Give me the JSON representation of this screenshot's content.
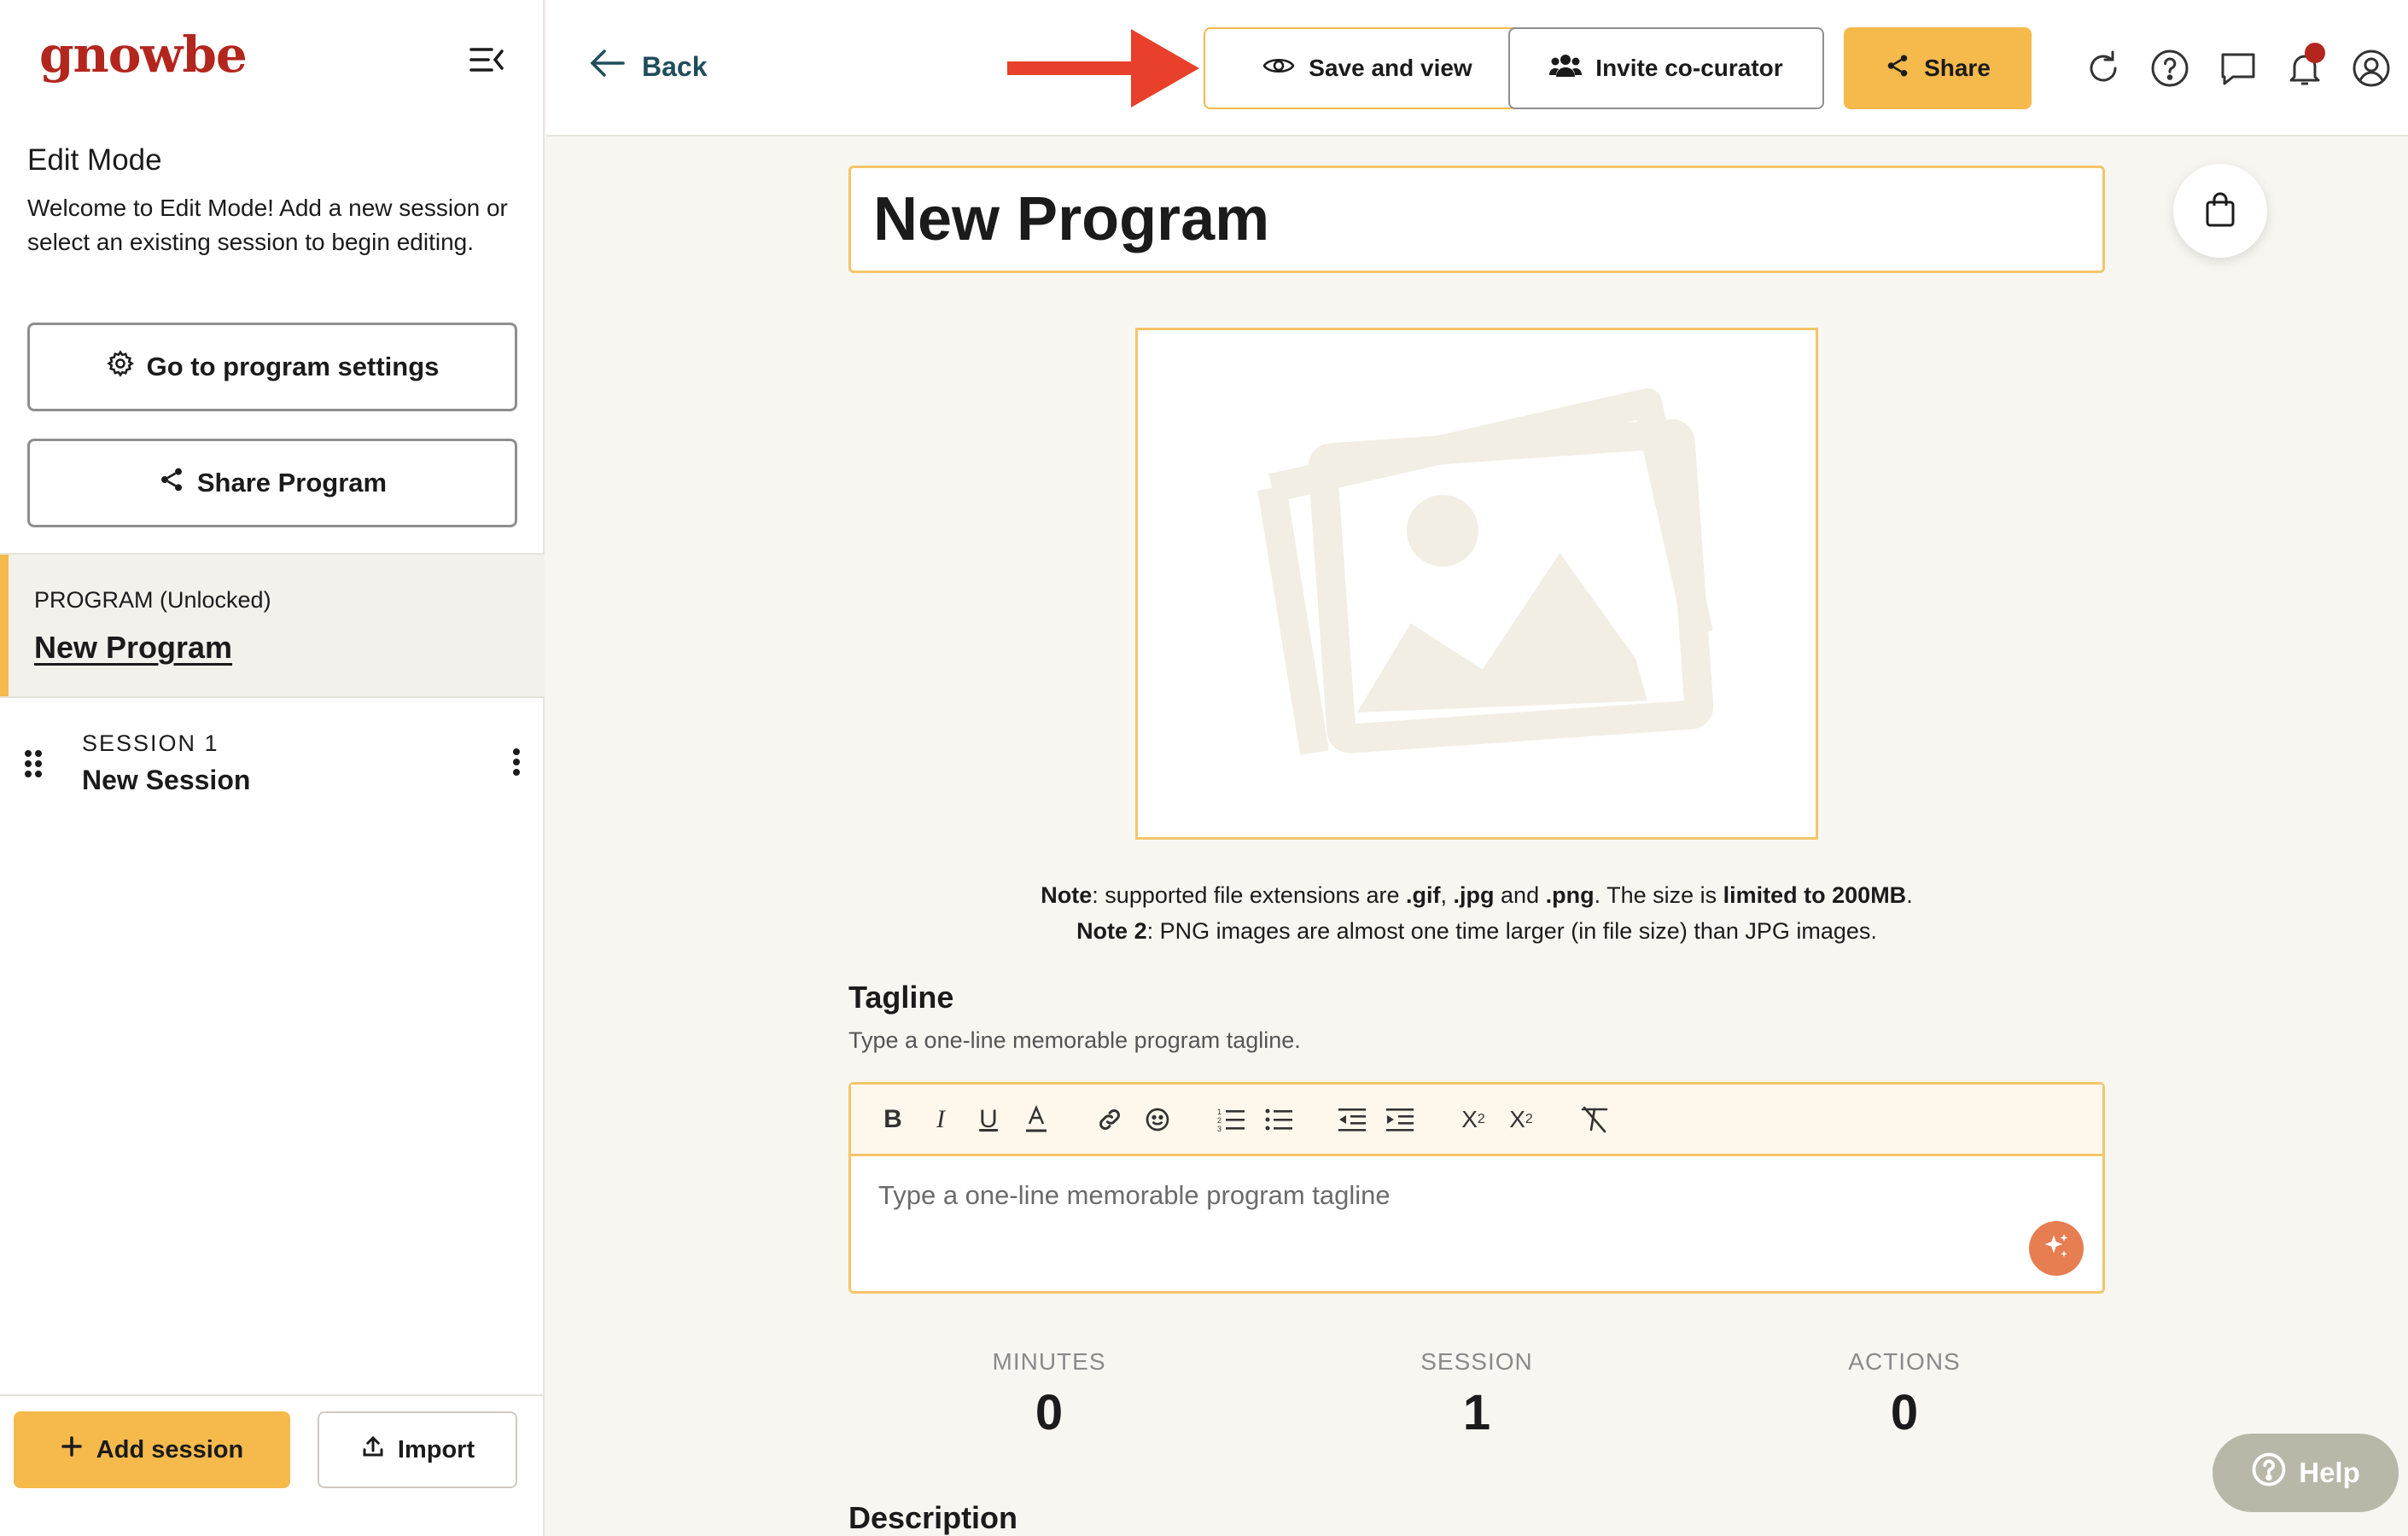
{
  "sidebar": {
    "logo": "gnowbe",
    "title": "Edit Mode",
    "description": "Welcome to Edit Mode! Add a new session or select an existing session to begin editing.",
    "program_settings_label": "Go to program settings",
    "share_program_label": "Share Program",
    "program": {
      "label": "PROGRAM (Unlocked)",
      "name": "New Program"
    },
    "sessions": [
      {
        "label": "SESSION 1",
        "name": "New Session"
      }
    ],
    "add_session_label": "Add session",
    "import_label": "Import"
  },
  "topbar": {
    "back_label": "Back",
    "save_view_label": "Save and view",
    "invite_label": "Invite co-curator",
    "share_label": "Share",
    "icons": [
      "refresh-icon",
      "help-icon",
      "chat-icon",
      "bell-icon",
      "account-icon"
    ],
    "has_notification": true
  },
  "main": {
    "program_title": "New Program",
    "note1": {
      "prefix": "Note",
      "t1": ": supported file extensions are ",
      "gif": ".gif",
      "sep1": ", ",
      "jpg": ".jpg",
      "and": " and ",
      "png": ".png",
      "t2": ". The size is ",
      "limit": "limited to 200MB",
      "end": "."
    },
    "note2": {
      "prefix": "Note 2",
      "text": ": PNG images are almost one time larger (in file size) than JPG images."
    },
    "tagline": {
      "heading": "Tagline",
      "subtitle": "Type a one-line memorable program tagline.",
      "placeholder": "Type a one-line memorable program tagline"
    },
    "stats": [
      {
        "label": "MINUTES",
        "value": "0"
      },
      {
        "label": "SESSION",
        "value": "1"
      },
      {
        "label": "ACTIONS",
        "value": "0"
      }
    ],
    "description_heading": "Description",
    "help_label": "Help"
  },
  "colors": {
    "accent": "#f5b94c",
    "brand": "#b3261e",
    "arrow": "#e8402b",
    "ai": "#e67e52"
  }
}
